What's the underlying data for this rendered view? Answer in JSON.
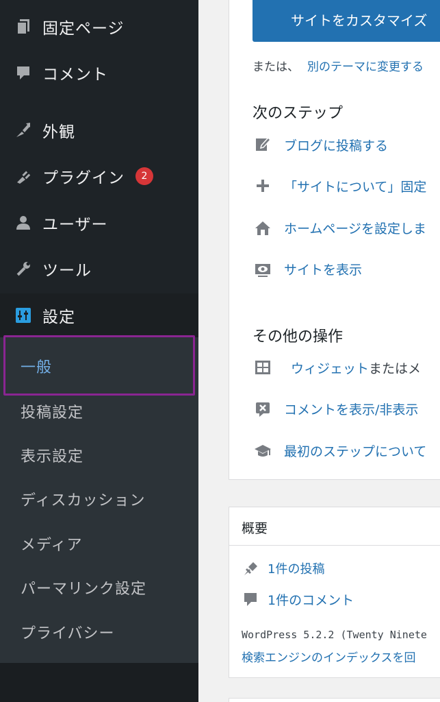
{
  "sidebar": {
    "items": [
      {
        "label": "固定ページ",
        "icon": "pages-icon"
      },
      {
        "label": "コメント",
        "icon": "comment-icon"
      },
      {
        "label": "外観",
        "icon": "brush-icon"
      },
      {
        "label": "プラグイン",
        "icon": "plugin-icon",
        "badge": "2"
      },
      {
        "label": "ユーザー",
        "icon": "user-icon"
      },
      {
        "label": "ツール",
        "icon": "wrench-icon"
      },
      {
        "label": "設定",
        "icon": "settings-icon"
      }
    ],
    "submenu": [
      "一般",
      "投稿設定",
      "表示設定",
      "ディスカッション",
      "メディア",
      "パーマリンク設定",
      "プライバシー"
    ]
  },
  "welcome": {
    "customize_button": "サイトをカスタマイズ",
    "or_text": "または、",
    "change_theme_link": "別のテーマに変更する",
    "next_steps_title": "次のステップ",
    "next_steps": [
      "ブログに投稿する",
      "「サイトについて」固定",
      "ホームページを設定しま",
      "サイトを表示"
    ],
    "more_actions_title": "その他の操作",
    "more_actions": [
      {
        "link": "ウィジェット",
        "rest": "またはメ"
      },
      {
        "link": "コメントを表示/非表示",
        "rest": ""
      },
      {
        "link": "最初のステップについて",
        "rest": ""
      }
    ]
  },
  "glance": {
    "title": "概要",
    "posts": "1件の投稿",
    "comments": "1件のコメント",
    "version_text": "WordPress 5.2.2 (Twenty Ninete",
    "search_engine_text": "検索エンジンのインデックスを回"
  },
  "colors": {
    "sidebar_bg": "#1e2327",
    "submenu_bg": "#2c3338",
    "accent_link": "#2271b1",
    "active_sub": "#72aee6",
    "badge": "#d63638",
    "highlight": "#8a2592"
  }
}
